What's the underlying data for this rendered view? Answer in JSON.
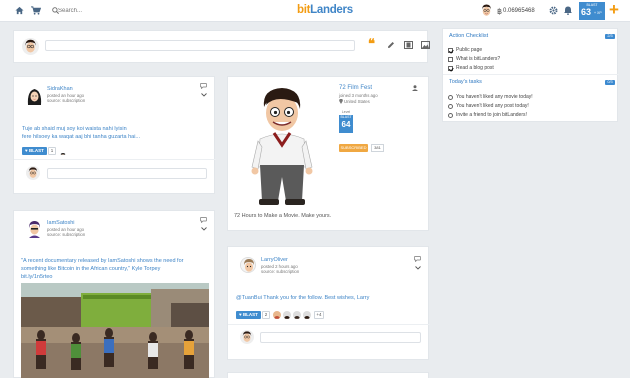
{
  "brand": {
    "name": "bitlanders",
    "bit": "bit",
    "landers": "Landers"
  },
  "search": {
    "placeholder": "Search..."
  },
  "header": {
    "balance": "0.06965468",
    "level_label": "BLAST",
    "level_value": "63",
    "level_suffix": "+ XP"
  },
  "composer": {
    "placeholder": ""
  },
  "posts": [
    {
      "author": "SidraKhan",
      "time": "posted an hour ago",
      "meta": "source: subscription",
      "text_lines": [
        "Tuje ab shaid muj soy koi waista nahi lyisin",
        "fere hilsoey ka waqat aaj bhi tanha guzarta hai..."
      ],
      "blast": "BLAST",
      "count": "1"
    },
    {
      "author": "IamSatoshi",
      "time": "posted an hour ago",
      "meta": "source: subscription",
      "text_lines": [
        "\"A recent documentary released by IamSatoshi shows the need for",
        "something like Bitcoin in the African country,\" Kyle Torpey",
        "bit.ly/1n5rteo"
      ]
    },
    {
      "author": "LarryOliver",
      "time": "posted 2 hours ago",
      "meta": "source: subscription",
      "text": "@TuanBui Thank you for the follow. Best wishes, Larry",
      "blast": "BLAST",
      "count": "2",
      "more": "+4"
    }
  ],
  "profile": {
    "name": "72 Film Fest",
    "joined": "joined 3 months ago",
    "location": "United States",
    "level_label": "Level",
    "level_tag": "BLAST",
    "level_value": "64",
    "subscribed": "SUBSCRIBED",
    "count": "381",
    "bio": "72 Hours to Make a Movie. Make yours."
  },
  "checklist": {
    "title": "Action Checklist",
    "badge": "2/3",
    "items": [
      {
        "label": "Public page",
        "checked": true
      },
      {
        "label": "What is bitLanders?",
        "checked": false
      },
      {
        "label": "Read a blog post",
        "checked": true
      }
    ]
  },
  "tasks": {
    "title": "Today's tasks",
    "badge": "0/3",
    "items": [
      {
        "label": "You haven't liked any movie today!"
      },
      {
        "label": "You haven't liked any post today!"
      },
      {
        "label": "Invite a friend to join bitLanders!"
      }
    ]
  },
  "colors": {
    "accent": "#3f85c7",
    "orange": "#f39c12",
    "background": "#e9ecef"
  }
}
